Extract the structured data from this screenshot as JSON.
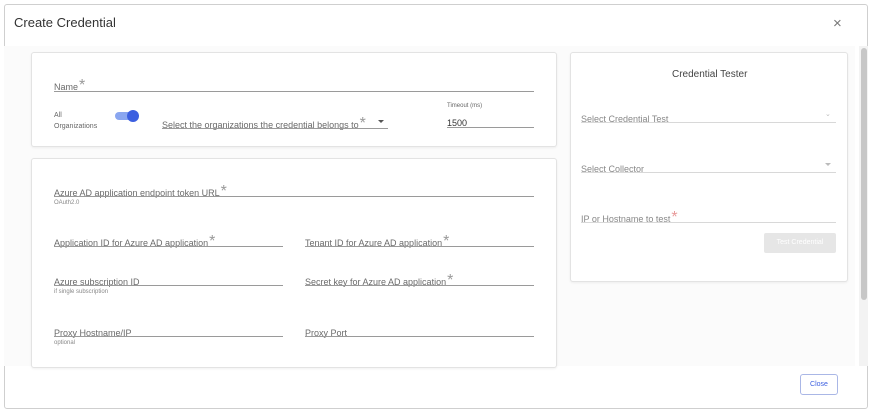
{
  "dialog": {
    "title": "Create Credential",
    "close_glyph": "×",
    "close_button_label": "Close"
  },
  "basic_card": {
    "name_label": "Name",
    "required_mark": "*",
    "all_orgs_line1": "All",
    "all_orgs_line2": "Organizations",
    "all_orgs_toggle_on": true,
    "orgs_select_label": "Select the organizations the credential belongs to",
    "timeout_label": "Timeout (ms)",
    "timeout_value": "1500"
  },
  "azure_card": {
    "token_url_label": "Azure AD application endpoint token URL",
    "token_url_hint": "OAuth2.0",
    "app_id_label": "Application ID for Azure AD application",
    "tenant_id_label": "Tenant ID for Azure AD application",
    "subscription_label": "Azure subscription ID",
    "subscription_hint": "if single subscription",
    "secret_key_label": "Secret key for Azure AD application",
    "proxy_host_label": "Proxy Hostname/IP",
    "proxy_host_hint": "optional",
    "proxy_port_label": "Proxy Port"
  },
  "tester": {
    "heading": "Credential Tester",
    "select_test_label": "Select Credential Test",
    "select_collector_label": "Select Collector",
    "host_label": "IP or Hostname to test",
    "test_button_label": "Test Credential"
  },
  "colors": {
    "accent": "#3c5fe0",
    "toggle_track": "#8aa6f0",
    "disabled_button": "#e6e6e6"
  }
}
